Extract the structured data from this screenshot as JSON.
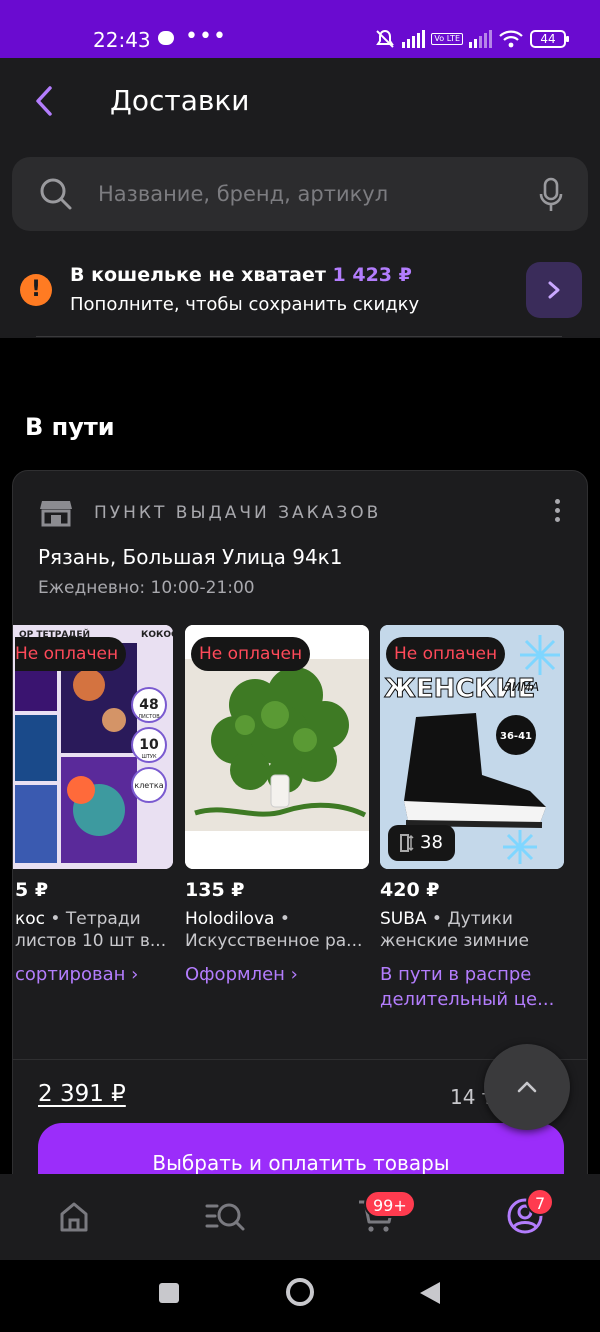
{
  "status_bar": {
    "time": "22:43",
    "dots": "•••",
    "lte_label": "Vo LTE",
    "battery": "44"
  },
  "header": {
    "title": "Доставки"
  },
  "search": {
    "placeholder": "Название, бренд, артикул"
  },
  "wallet": {
    "title": "В кошельке не хватает",
    "amount": "1 423 ₽",
    "subtitle": "Пополните, чтобы сохранить скидку"
  },
  "section": {
    "title": "В пути"
  },
  "pickup": {
    "label": "ПУНКТ ВЫДАЧИ ЗАКАЗОВ",
    "address": "Рязань, Большая Улица 94к1",
    "hours": "Ежедневно: 10:00-21:00"
  },
  "products": [
    {
      "badge": "Не оплачен",
      "price": "5 ₽",
      "brand": "кос",
      "desc": "Тетради",
      "desc2": "листов 10 шт в...",
      "status": "сортирован ›",
      "img_texts": [
        "ОР ТЕТРАДЕЙ",
        "КОКОС",
        "48",
        "ЛИСТОВ",
        "10",
        "ШТУК",
        "клетка"
      ]
    },
    {
      "badge": "Не оплачен",
      "price": "135 ₽",
      "brand": "Holodilova",
      "desc": "",
      "desc2": "Искусственное ра...",
      "status": "Оформлен ›"
    },
    {
      "badge": "Не оплачен",
      "price": "420 ₽",
      "brand": "SUBA",
      "desc": "Дутики",
      "desc2": "женские зимние",
      "status": "В пути в распре",
      "status2": "делительный це...",
      "size": "38",
      "img_texts": [
        "ЖЕНСКИЕ",
        "ЗИМА",
        "36-41"
      ]
    }
  ],
  "summary": {
    "total": "2 391 ₽",
    "count": "14 т"
  },
  "pay_button": {
    "label": "Выбрать и оплатить товары"
  },
  "tabbar": {
    "cart_badge": "99+",
    "profile_badge": "7"
  },
  "colors": {
    "status_bar": "#6a0bd0",
    "accent": "#b37dfd",
    "button": "#9b2dfa",
    "badge_text": "#ff4a5a",
    "warning": "#ff7b22"
  }
}
